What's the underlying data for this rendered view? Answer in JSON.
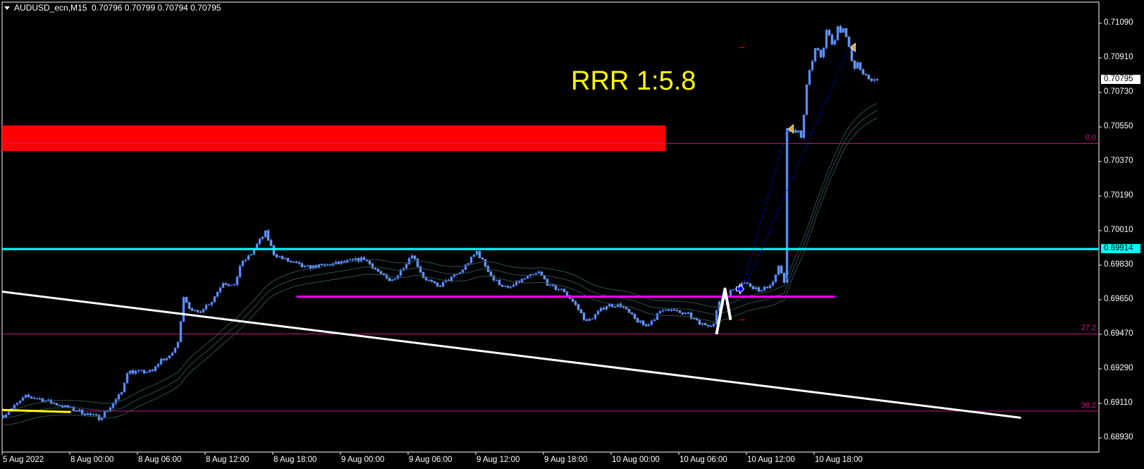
{
  "header": {
    "symbol": "AUDUSD_ecn,M15",
    "ohlc": "0.70796 0.70799 0.70794 0.70795",
    "annotation": "RRR 1:5.8"
  },
  "colors": {
    "background": "#000000",
    "candle": "#6495ED",
    "candle_edge": "#2f5fe0",
    "ma": "#2f4f4f",
    "supply_zone": "#ff0000",
    "resistance": "#00ffff",
    "support": "#ff00ff",
    "fib": "#c71585",
    "trendline": "#ffffff",
    "annotation": "#ffff00",
    "target_marker": "#daa520",
    "entry_marker": "#0000ff"
  },
  "chart_data": {
    "type": "candlestick",
    "title": "AUDUSD_ecn,M15",
    "timeframe": "M15",
    "bar_count": 311,
    "ylim": [
      0.6883,
      0.712
    ],
    "y_ticks": [
      "0.71090",
      "0.70910",
      "0.70730",
      "0.70550",
      "0.70370",
      "0.70190",
      "0.70010",
      "0.69830",
      "0.69650",
      "0.69470",
      "0.69290",
      "0.69110",
      "0.68930"
    ],
    "x_ticks": [
      {
        "bar": 0,
        "label": "5 Aug 2022"
      },
      {
        "bar": 24,
        "label": "8 Aug 00:00"
      },
      {
        "bar": 48,
        "label": "8 Aug 06:00"
      },
      {
        "bar": 72,
        "label": "8 Aug 12:00"
      },
      {
        "bar": 96,
        "label": "8 Aug 18:00"
      },
      {
        "bar": 120,
        "label": "9 Aug 00:00"
      },
      {
        "bar": 144,
        "label": "9 Aug 06:00"
      },
      {
        "bar": 168,
        "label": "9 Aug 12:00"
      },
      {
        "bar": 192,
        "label": "9 Aug 18:00"
      },
      {
        "bar": 216,
        "label": "10 Aug 00:00"
      },
      {
        "bar": 240,
        "label": "10 Aug 06:00"
      },
      {
        "bar": 264,
        "label": "10 Aug 12:00"
      },
      {
        "bar": 288,
        "label": "10 Aug 18:00"
      }
    ],
    "close_keypoints": [
      [
        0,
        0.69046
      ],
      [
        8,
        0.69145
      ],
      [
        12,
        0.69138
      ],
      [
        24,
        0.69083
      ],
      [
        34,
        0.69035
      ],
      [
        38,
        0.6909
      ],
      [
        42,
        0.69167
      ],
      [
        44,
        0.69277
      ],
      [
        49,
        0.69273
      ],
      [
        53,
        0.69277
      ],
      [
        56,
        0.69339
      ],
      [
        59,
        0.6935
      ],
      [
        62,
        0.69424
      ],
      [
        64,
        0.6967
      ],
      [
        67,
        0.69585
      ],
      [
        69,
        0.69585
      ],
      [
        74,
        0.69644
      ],
      [
        78,
        0.69743
      ],
      [
        82,
        0.69717
      ],
      [
        84,
        0.69828
      ],
      [
        88,
        0.6989
      ],
      [
        90,
        0.69938
      ],
      [
        93,
        0.7
      ],
      [
        96,
        0.6989
      ],
      [
        99,
        0.69864
      ],
      [
        107,
        0.69817
      ],
      [
        114,
        0.69828
      ],
      [
        124,
        0.69853
      ],
      [
        128,
        0.69864
      ],
      [
        137,
        0.69743
      ],
      [
        140,
        0.6978
      ],
      [
        145,
        0.6989
      ],
      [
        149,
        0.69769
      ],
      [
        154,
        0.69717
      ],
      [
        162,
        0.69791
      ],
      [
        168,
        0.69901
      ],
      [
        174,
        0.69754
      ],
      [
        179,
        0.69706
      ],
      [
        184,
        0.69754
      ],
      [
        190,
        0.69791
      ],
      [
        194,
        0.69717
      ],
      [
        199,
        0.69695
      ],
      [
        203,
        0.69622
      ],
      [
        207,
        0.69534
      ],
      [
        210,
        0.69571
      ],
      [
        214,
        0.69622
      ],
      [
        219,
        0.69622
      ],
      [
        224,
        0.69549
      ],
      [
        228,
        0.69512
      ],
      [
        232,
        0.69571
      ],
      [
        235,
        0.69607
      ],
      [
        239,
        0.69585
      ],
      [
        243,
        0.69571
      ],
      [
        247,
        0.69523
      ],
      [
        252,
        0.69523
      ],
      [
        254,
        0.69644
      ],
      [
        262,
        0.69743
      ],
      [
        266,
        0.69717
      ],
      [
        269,
        0.69695
      ],
      [
        273,
        0.69743
      ],
      [
        275,
        0.69817
      ],
      [
        277,
        0.69743
      ],
      [
        278,
        0.70551
      ],
      [
        279,
        0.70525
      ],
      [
        282,
        0.70525
      ],
      [
        283,
        0.70488
      ],
      [
        284,
        0.70624
      ],
      [
        285,
        0.70771
      ],
      [
        286,
        0.70855
      ],
      [
        287,
        0.70892
      ],
      [
        288,
        0.70954
      ],
      [
        289,
        0.70943
      ],
      [
        290,
        0.70907
      ],
      [
        291,
        0.70965
      ],
      [
        292,
        0.71064
      ],
      [
        294,
        0.70991
      ],
      [
        295,
        0.70991
      ],
      [
        296,
        0.71064
      ],
      [
        297,
        0.71039
      ],
      [
        298,
        0.71064
      ],
      [
        299,
        0.71017
      ],
      [
        300,
        0.70965
      ],
      [
        302,
        0.70844
      ],
      [
        303,
        0.70892
      ],
      [
        304,
        0.70844
      ],
      [
        305,
        0.70818
      ],
      [
        307,
        0.70807
      ],
      [
        308,
        0.70796
      ],
      [
        310,
        0.70795
      ]
    ],
    "last_price": "0.70795",
    "moving_average_envelope": {
      "period": 40,
      "offset": 0.00038
    },
    "objects": {
      "supply_zone": {
        "bar_from": 0,
        "bar_to": 235,
        "price_top": 0.70558,
        "price_bottom": 0.70425
      },
      "resistance_line": {
        "price": 0.69914,
        "label": "0.69914"
      },
      "support_line": {
        "bar_from": 104,
        "bar_to": 295,
        "price": 0.69666
      },
      "fib_levels": [
        {
          "label": "0.0",
          "price": 0.70464
        },
        {
          "label": "27.2",
          "price": 0.69472
        },
        {
          "label": "38.2",
          "price": 0.6907
        }
      ],
      "trendline": {
        "bar_from": 0,
        "price_from": 0.69692,
        "bar_to": 361,
        "price_to": 0.69035
      },
      "yellow_line": {
        "bar_from": 0,
        "price_from": 0.69076,
        "bar_to": 24,
        "price_to": 0.69065
      },
      "zigzag": [
        [
          253,
          0.6947
        ],
        [
          256,
          0.69706
        ],
        [
          258,
          0.69545
        ]
      ],
      "entry": {
        "bar": 261,
        "price": 0.69706
      },
      "targets": [
        {
          "bar": 278,
          "price": 0.7054
        },
        {
          "bar": 300,
          "price": 0.70964
        }
      ],
      "dashes": [
        {
          "bar": 262,
          "price": 0.70964
        },
        {
          "bar": 262,
          "price": 0.69545
        }
      ]
    }
  }
}
